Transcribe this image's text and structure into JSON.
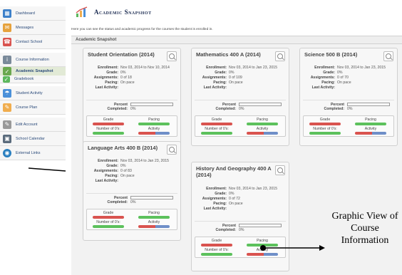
{
  "sidebar": {
    "items": [
      {
        "label": "Dashboard",
        "icon": "dashboard-icon"
      },
      {
        "label": "Messages",
        "icon": "messages-icon"
      },
      {
        "label": "Contact School",
        "icon": "contact-icon"
      },
      {
        "label": "Course Information",
        "icon": "course-info-icon"
      },
      {
        "label": "Academic Snapshot",
        "icon": "snapshot-icon"
      },
      {
        "label": "Gradebook",
        "icon": "gradebook-icon"
      },
      {
        "label": "Student Activity",
        "icon": "activity-icon"
      },
      {
        "label": "Course Plan",
        "icon": "course-plan-icon"
      },
      {
        "label": "Edit Account",
        "icon": "edit-account-icon"
      },
      {
        "label": "School Calendar",
        "icon": "calendar-icon"
      },
      {
        "label": "External Links",
        "icon": "links-icon"
      }
    ]
  },
  "header": {
    "title": "Academic Snapshot",
    "description": "Here you can see the status and academic progress for the courses the student is enrolled in.",
    "section": "Academic Snapshot"
  },
  "labels": {
    "enrollment": "Enrollment:",
    "grade": "Grade:",
    "assignments": "Assignments:",
    "pacing": "Pacing:",
    "last_activity": "Last Activity:",
    "percent": "Percent Completed:",
    "g_grade": "Grade",
    "g_pacing": "Pacing",
    "g_zeros": "Number of 0's:",
    "g_activity": "Activity"
  },
  "courses": [
    {
      "title": "Student Orientation (2014)",
      "enrollment": "Nov 03, 2014 to Nov 10, 2014",
      "grade": "0%",
      "assignments": "0 of 18",
      "pacing": "On pace",
      "last_activity": "",
      "percent": "0%"
    },
    {
      "title": "Mathematics 400 A (2014)",
      "enrollment": "Nov 03, 2014 to Jan 23, 2015",
      "grade": "0%",
      "assignments": "0 of 109",
      "pacing": "On pace",
      "last_activity": "",
      "percent": "0%"
    },
    {
      "title": "Science 500 B (2014)",
      "enrollment": "Nov 03, 2014 to Jan 23, 2015",
      "grade": "0%",
      "assignments": "0 of 70",
      "pacing": "On pace",
      "last_activity": "",
      "percent": "0%"
    },
    {
      "title": "Language Arts 400 B (2014)",
      "enrollment": "Nov 03, 2014 to Jan 23, 2015",
      "grade": "0%",
      "assignments": "0 of 83",
      "pacing": "On pace",
      "last_activity": "",
      "percent": "0%"
    },
    {
      "title": "History And Geography 400 A (2014)",
      "enrollment": "Nov 03, 2014 to Jan 23, 2015",
      "grade": "0%",
      "assignments": "0 of 72",
      "pacing": "On pace",
      "last_activity": "",
      "percent": "0%"
    }
  ],
  "annotation": {
    "text": "Graphic View of Course Information"
  },
  "colors": {
    "green": "#5cc15c",
    "red": "#d9534f",
    "blue": "#6f8fc8"
  }
}
